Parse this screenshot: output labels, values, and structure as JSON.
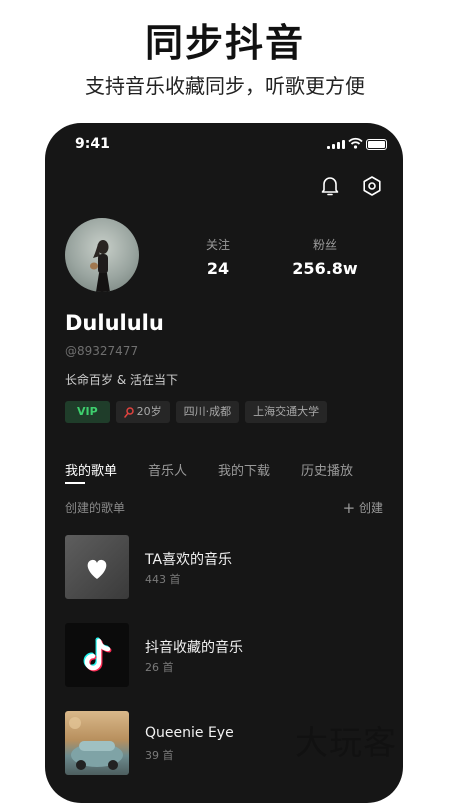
{
  "promo": {
    "title": "同步抖音",
    "subtitle": "支持音乐收藏同步，听歌更方便"
  },
  "status_bar": {
    "time": "9:41"
  },
  "profile": {
    "following_label": "关注",
    "following_count": "24",
    "followers_label": "粉丝",
    "followers_count": "256.8w",
    "username": "Dulululu",
    "handle": "@89327477",
    "bio": "长命百岁 & 活在当下",
    "tags": {
      "vip": "VIP",
      "age": "20岁",
      "location": "四川·成都",
      "school": "上海交通大学"
    }
  },
  "tabs": [
    "我的歌单",
    "音乐人",
    "我的下载",
    "历史播放"
  ],
  "section": {
    "title": "创建的歌单",
    "create_label": "创建"
  },
  "playlists": [
    {
      "name": "TA喜欢的音乐",
      "count": "443 首"
    },
    {
      "name": "抖音收藏的音乐",
      "count": "26 首"
    },
    {
      "name": "Queenie Eye",
      "count": "39 首"
    }
  ],
  "watermark": "大玩客",
  "colors": {
    "vip_green": "#3ecf6e",
    "tag_red": "#e0433f",
    "phone_bg": "#161616"
  }
}
